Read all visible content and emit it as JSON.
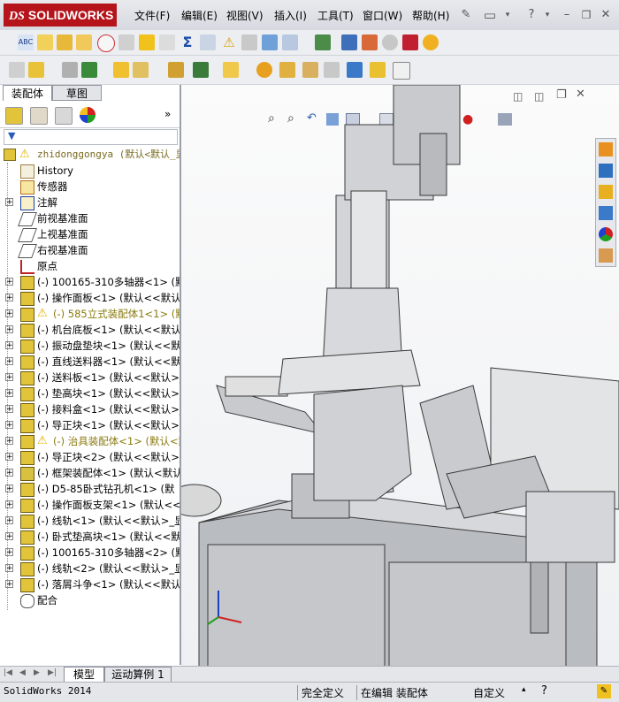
{
  "app": {
    "name": "SOLIDWORKS",
    "brand_color": "#b5141b"
  },
  "menu": [
    "文件(F)",
    "编辑(E)",
    "视图(V)",
    "插入(I)",
    "工具(T)",
    "窗口(W)",
    "帮助(H)"
  ],
  "panel_tabs": [
    "装配体",
    "草图"
  ],
  "tree": {
    "root_label": "zhidonggongya  (默认<默认_显",
    "items": [
      {
        "label": "History",
        "icon": "history-icon",
        "expand": ""
      },
      {
        "label": "传感器",
        "icon": "sensor-icon",
        "expand": ""
      },
      {
        "label": "注解",
        "icon": "annotation-icon",
        "expand": "+"
      },
      {
        "label": "前视基准面",
        "icon": "plane-icon",
        "expand": ""
      },
      {
        "label": "上视基准面",
        "icon": "plane-icon",
        "expand": ""
      },
      {
        "label": "右视基准面",
        "icon": "plane-icon",
        "expand": ""
      },
      {
        "label": "原点",
        "icon": "origin-icon",
        "expand": ""
      },
      {
        "label": "(-) 100165-310多轴器<1> (默",
        "icon": "part-icon",
        "expand": "+"
      },
      {
        "label": "(-) 操作面板<1> (默认<<默认>",
        "icon": "part-icon",
        "expand": "+"
      },
      {
        "label": "(-) 585立式装配体1<1> (默",
        "icon": "warning-assembly-icon",
        "expand": "+",
        "warn": true
      },
      {
        "label": "(-) 机台底板<1> (默认<<默认",
        "icon": "part-icon",
        "expand": "+"
      },
      {
        "label": "(-) 振动盘垫块<1> (默认<<默",
        "icon": "part-icon",
        "expand": "+"
      },
      {
        "label": "(-) 直线送料器<1> (默认<<默",
        "icon": "part-icon",
        "expand": "+"
      },
      {
        "label": "(-) 送料板<1> (默认<<默认>_",
        "icon": "part-icon",
        "expand": "+"
      },
      {
        "label": "(-) 垫高块<1> (默认<<默认>_",
        "icon": "part-icon",
        "expand": "+"
      },
      {
        "label": "(-) 接料盒<1> (默认<<默认>_",
        "icon": "part-icon",
        "expand": "+"
      },
      {
        "label": "(-) 导正块<1> (默认<<默认>_",
        "icon": "part-icon",
        "expand": "+"
      },
      {
        "label": "(-) 治具装配体<1> (默认<默",
        "icon": "warning-assembly-icon",
        "expand": "+",
        "warn": true
      },
      {
        "label": "(-) 导正块<2> (默认<<默认>_",
        "icon": "part-icon",
        "expand": "+"
      },
      {
        "label": "(-) 框架装配体<1> (默认<默认",
        "icon": "assembly-icon",
        "expand": "+"
      },
      {
        "label": "(-) D5-85卧式钻孔机<1> (默",
        "icon": "part-icon",
        "expand": "+"
      },
      {
        "label": "(-) 操作面板支架<1> (默认<<",
        "icon": "part-icon",
        "expand": "+"
      },
      {
        "label": "(-) 线轨<1> (默认<<默认>_显",
        "icon": "part-icon",
        "expand": "+"
      },
      {
        "label": "(-) 卧式垫高块<1> (默认<<默",
        "icon": "part-icon",
        "expand": "+"
      },
      {
        "label": "(-) 100165-310多轴器<2> (默",
        "icon": "part-icon",
        "expand": "+"
      },
      {
        "label": "(-) 线轨<2> (默认<<默认>_显",
        "icon": "part-icon",
        "expand": "+"
      },
      {
        "label": "(-) 落屑斗争<1> (默认<<默认",
        "icon": "part-icon",
        "expand": "+"
      },
      {
        "label": "配合",
        "icon": "mates-icon",
        "expand": ""
      }
    ]
  },
  "bottom_tabs": [
    "模型",
    "运动算例 1"
  ],
  "status": {
    "app_version": "SolidWorks 2014",
    "definition": "完全定义",
    "editing": "在编辑 装配体",
    "units": "自定义"
  },
  "colors": {
    "warning": "#e8c300",
    "part_yellow": "#e2c43a",
    "panel_border": "#9aa0aa"
  }
}
